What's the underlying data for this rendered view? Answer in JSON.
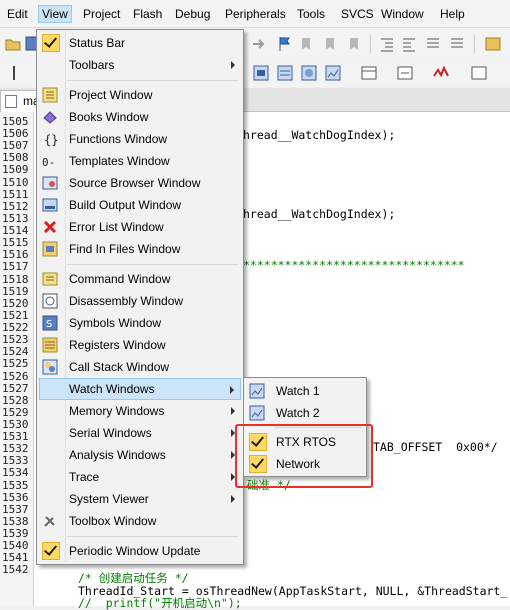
{
  "menubar": {
    "items": [
      "Edit",
      "View",
      "Project",
      "Flash",
      "Debug",
      "Peripherals",
      "Tools",
      "SVCS",
      "Window",
      "Help"
    ]
  },
  "tab": {
    "label": "ma"
  },
  "view_menu": {
    "items": [
      {
        "label": "Status Bar",
        "checked": true
      },
      {
        "label": "Toolbars",
        "submenu": true
      },
      {
        "label": "Project Window",
        "icon": "project-window-icon"
      },
      {
        "label": "Books Window",
        "icon": "books-icon"
      },
      {
        "label": "Functions Window",
        "icon": "functions-icon"
      },
      {
        "label": "Templates Window",
        "icon": "templates-icon"
      },
      {
        "label": "Source Browser Window",
        "icon": "source-browser-icon"
      },
      {
        "label": "Build Output Window",
        "icon": "build-output-icon"
      },
      {
        "label": "Error List Window",
        "icon": "error-x-icon"
      },
      {
        "label": "Find In Files Window",
        "icon": "find-in-files-icon"
      },
      {
        "label": "Command Window",
        "icon": "command-icon"
      },
      {
        "label": "Disassembly Window",
        "icon": "disassembly-icon"
      },
      {
        "label": "Symbols Window",
        "icon": "symbols-icon"
      },
      {
        "label": "Registers Window",
        "icon": "registers-icon"
      },
      {
        "label": "Call Stack Window",
        "icon": "call-stack-icon"
      },
      {
        "label": "Watch Windows",
        "submenu": true,
        "highlighted": true
      },
      {
        "label": "Memory Windows",
        "submenu": true
      },
      {
        "label": "Serial Windows",
        "submenu": true
      },
      {
        "label": "Analysis Windows",
        "submenu": true
      },
      {
        "label": "Trace",
        "submenu": true
      },
      {
        "label": "System Viewer",
        "submenu": true
      },
      {
        "label": "Toolbox Window",
        "icon": "toolbox-icon"
      },
      {
        "label": "Periodic Window Update",
        "checked": true
      }
    ]
  },
  "watch_submenu": {
    "items": [
      {
        "label": "Watch 1"
      },
      {
        "label": "Watch 2"
      },
      {
        "label": "RTX RTOS",
        "checked": true
      },
      {
        "label": "Network",
        "checked": true
      }
    ]
  },
  "editor": {
    "line_numbers": [
      "1505",
      "1506",
      "1507",
      "1508",
      "1509",
      "1510",
      "1511",
      "1512",
      "1513",
      "1514",
      "1515",
      "1516",
      "1517",
      "1518",
      "1519",
      "1520",
      "1521",
      "1522",
      "1523",
      "1524",
      "1525",
      "1526",
      "1527",
      "1528",
      "1529",
      "1530",
      "1531",
      "1532",
      "1533",
      "1534",
      "1535",
      "1536",
      "1537",
      "1538",
      "1539",
      "1540",
      "1541",
      "1542"
    ],
    "code": {
      "l1": "hread__WatchDogIndex);",
      "l2": "hread__WatchDogIndex);",
      "l3": "********************************",
      "l4": "TAB_OFFSET  0x00*/",
      "l5": "础准 */",
      "l6": "/* 创建启动任务 */",
      "l7": "ThreadId_Start = osThreadNew(AppTaskStart, NULL, &ThreadStart_",
      "l8": "//  printf(\"开机启动\\n\");"
    }
  },
  "colors": {
    "highlight": "#cce4f7",
    "check_bg": "#ffd966",
    "annotation_red": "#e8312a",
    "comment_green": "#008000"
  }
}
